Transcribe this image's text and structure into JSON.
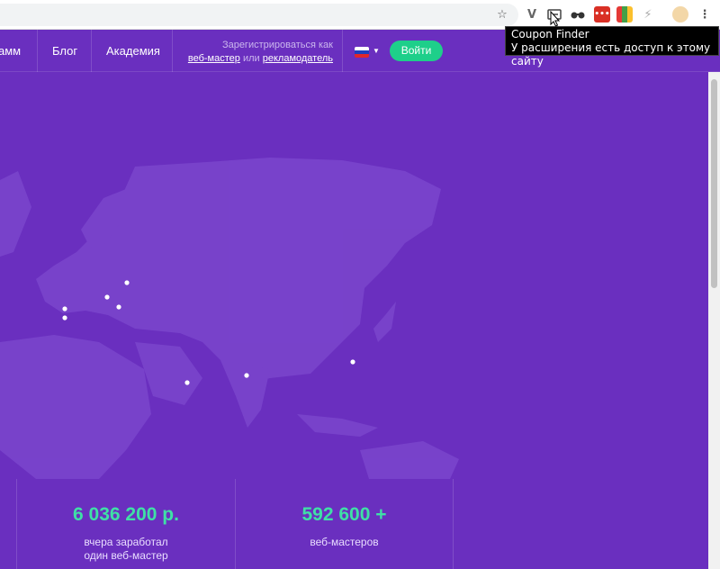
{
  "tooltip": {
    "title": "Coupon Finder",
    "subtitle": "У расширения есть доступ к этому сайту"
  },
  "nav": {
    "items": [
      "амм",
      "Блог",
      "Академия"
    ]
  },
  "register": {
    "prefix": "Зарегистрироваться как",
    "webmaster": "веб-мастер",
    "or": "или",
    "advertiser": "рекламодатель"
  },
  "login_label": "Войти",
  "stats": [
    {
      "value": "6 036 200 р.",
      "label1": "вчера заработал",
      "label2": "один веб-мастер"
    },
    {
      "value": "592 600 +",
      "label1": "веб-мастеров",
      "label2": ""
    }
  ],
  "colors": {
    "background": "#6a2fbf",
    "accent": "#1ecf8a",
    "stat_value": "#3fe0a6"
  },
  "icons": [
    "star-icon",
    "vivaldi-extension-icon",
    "coupon-finder-icon",
    "binoculars-icon",
    "red-extension-icon",
    "colorful-extension-icon",
    "bolt-icon",
    "profile-avatar-icon",
    "menu-dots-icon"
  ]
}
